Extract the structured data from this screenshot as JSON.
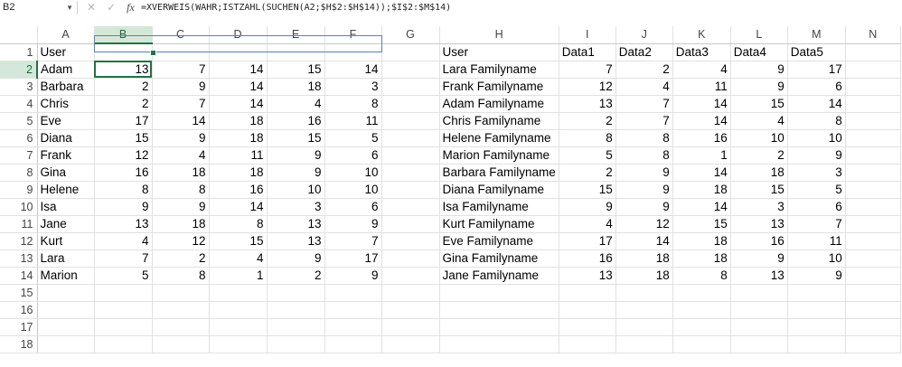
{
  "formula_bar": {
    "name_box": "B2",
    "fx_label": "fx",
    "formula": "=XVERWEIS(WAHR;ISTZAHL(SUCHEN(A2;$H$2:$H$14));$I$2:$M$14)"
  },
  "columns": [
    "A",
    "B",
    "C",
    "D",
    "E",
    "F",
    "G",
    "H",
    "I",
    "J",
    "K",
    "L",
    "M",
    "N"
  ],
  "rows": [
    [
      "User",
      "",
      "",
      "",
      "",
      "",
      "",
      "User",
      "Data1",
      "Data2",
      "Data3",
      "Data4",
      "Data5",
      ""
    ],
    [
      "Adam",
      "13",
      "7",
      "14",
      "15",
      "14",
      "",
      "Lara Familyname",
      "7",
      "2",
      "4",
      "9",
      "17",
      ""
    ],
    [
      "Barbara",
      "2",
      "9",
      "14",
      "18",
      "3",
      "",
      "Frank Familyname",
      "12",
      "4",
      "11",
      "9",
      "6",
      ""
    ],
    [
      "Chris",
      "2",
      "7",
      "14",
      "4",
      "8",
      "",
      "Adam Familyname",
      "13",
      "7",
      "14",
      "15",
      "14",
      ""
    ],
    [
      "Eve",
      "17",
      "14",
      "18",
      "16",
      "11",
      "",
      "Chris Familyname",
      "2",
      "7",
      "14",
      "4",
      "8",
      ""
    ],
    [
      "Diana",
      "15",
      "9",
      "18",
      "15",
      "5",
      "",
      "Helene Familyname",
      "8",
      "8",
      "16",
      "10",
      "10",
      ""
    ],
    [
      "Frank",
      "12",
      "4",
      "11",
      "9",
      "6",
      "",
      "Marion Familyname",
      "5",
      "8",
      "1",
      "2",
      "9",
      ""
    ],
    [
      "Gina",
      "16",
      "18",
      "18",
      "9",
      "10",
      "",
      "Barbara Familyname",
      "2",
      "9",
      "14",
      "18",
      "3",
      ""
    ],
    [
      "Helene",
      "8",
      "8",
      "16",
      "10",
      "10",
      "",
      "Diana Familyname",
      "15",
      "9",
      "18",
      "15",
      "5",
      ""
    ],
    [
      "Isa",
      "9",
      "9",
      "14",
      "3",
      "6",
      "",
      "Isa Familyname",
      "9",
      "9",
      "14",
      "3",
      "6",
      ""
    ],
    [
      "Jane",
      "13",
      "18",
      "8",
      "13",
      "9",
      "",
      "Kurt Familyname",
      "4",
      "12",
      "15",
      "13",
      "7",
      ""
    ],
    [
      "Kurt",
      "4",
      "12",
      "15",
      "13",
      "7",
      "",
      "Eve Familyname",
      "17",
      "14",
      "18",
      "16",
      "11",
      ""
    ],
    [
      "Lara",
      "7",
      "2",
      "4",
      "9",
      "17",
      "",
      "Gina Familyname",
      "16",
      "18",
      "18",
      "9",
      "10",
      ""
    ],
    [
      "Marion",
      "5",
      "8",
      "1",
      "2",
      "9",
      "",
      "Jane Familyname",
      "13",
      "18",
      "8",
      "13",
      "9",
      ""
    ],
    [
      "",
      "",
      "",
      "",
      "",
      "",
      "",
      "",
      "",
      "",
      "",
      "",
      "",
      ""
    ],
    [
      "",
      "",
      "",
      "",
      "",
      "",
      "",
      "",
      "",
      "",
      "",
      "",
      "",
      ""
    ],
    [
      "",
      "",
      "",
      "",
      "",
      "",
      "",
      "",
      "",
      "",
      "",
      "",
      "",
      ""
    ],
    [
      "",
      "",
      "",
      "",
      "",
      "",
      "",
      "",
      "",
      "",
      "",
      "",
      "",
      ""
    ]
  ],
  "row_numbers": [
    "1",
    "2",
    "3",
    "4",
    "5",
    "6",
    "7",
    "8",
    "9",
    "10",
    "11",
    "12",
    "13",
    "14",
    "15",
    "16",
    "17",
    "18"
  ],
  "accent_color": "#217346"
}
